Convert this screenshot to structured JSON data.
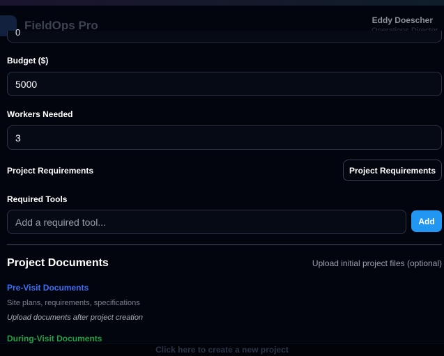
{
  "app": {
    "title": "FieldOps Pro",
    "user_name": "Eddy Doescher",
    "user_role": "Operations Director"
  },
  "form": {
    "top_field_value": "0",
    "budget": {
      "label": "Budget ($)",
      "value": "5000"
    },
    "workers": {
      "label": "Workers Needed",
      "value": "3"
    },
    "requirements": {
      "label": "Project Requirements",
      "button_label": "Project Requirements"
    },
    "tools": {
      "label": "Required Tools",
      "placeholder": "Add a required tool...",
      "add_label": "Add"
    }
  },
  "documents": {
    "title": "Project Documents",
    "subtitle": "Upload initial project files (optional)",
    "pre_visit": {
      "heading": "Pre-Visit Documents",
      "description": "Site plans, requirements, specifications",
      "note": "Upload documents after project creation"
    },
    "during_visit": {
      "heading": "During-Visit Documents"
    }
  },
  "footer": {
    "link": "Click here to create a new project"
  },
  "colors": {
    "accent": "#2196f3",
    "pre_visit_heading": "#3b6ff5",
    "during_visit_heading": "#22a045",
    "background": "#02050e"
  }
}
